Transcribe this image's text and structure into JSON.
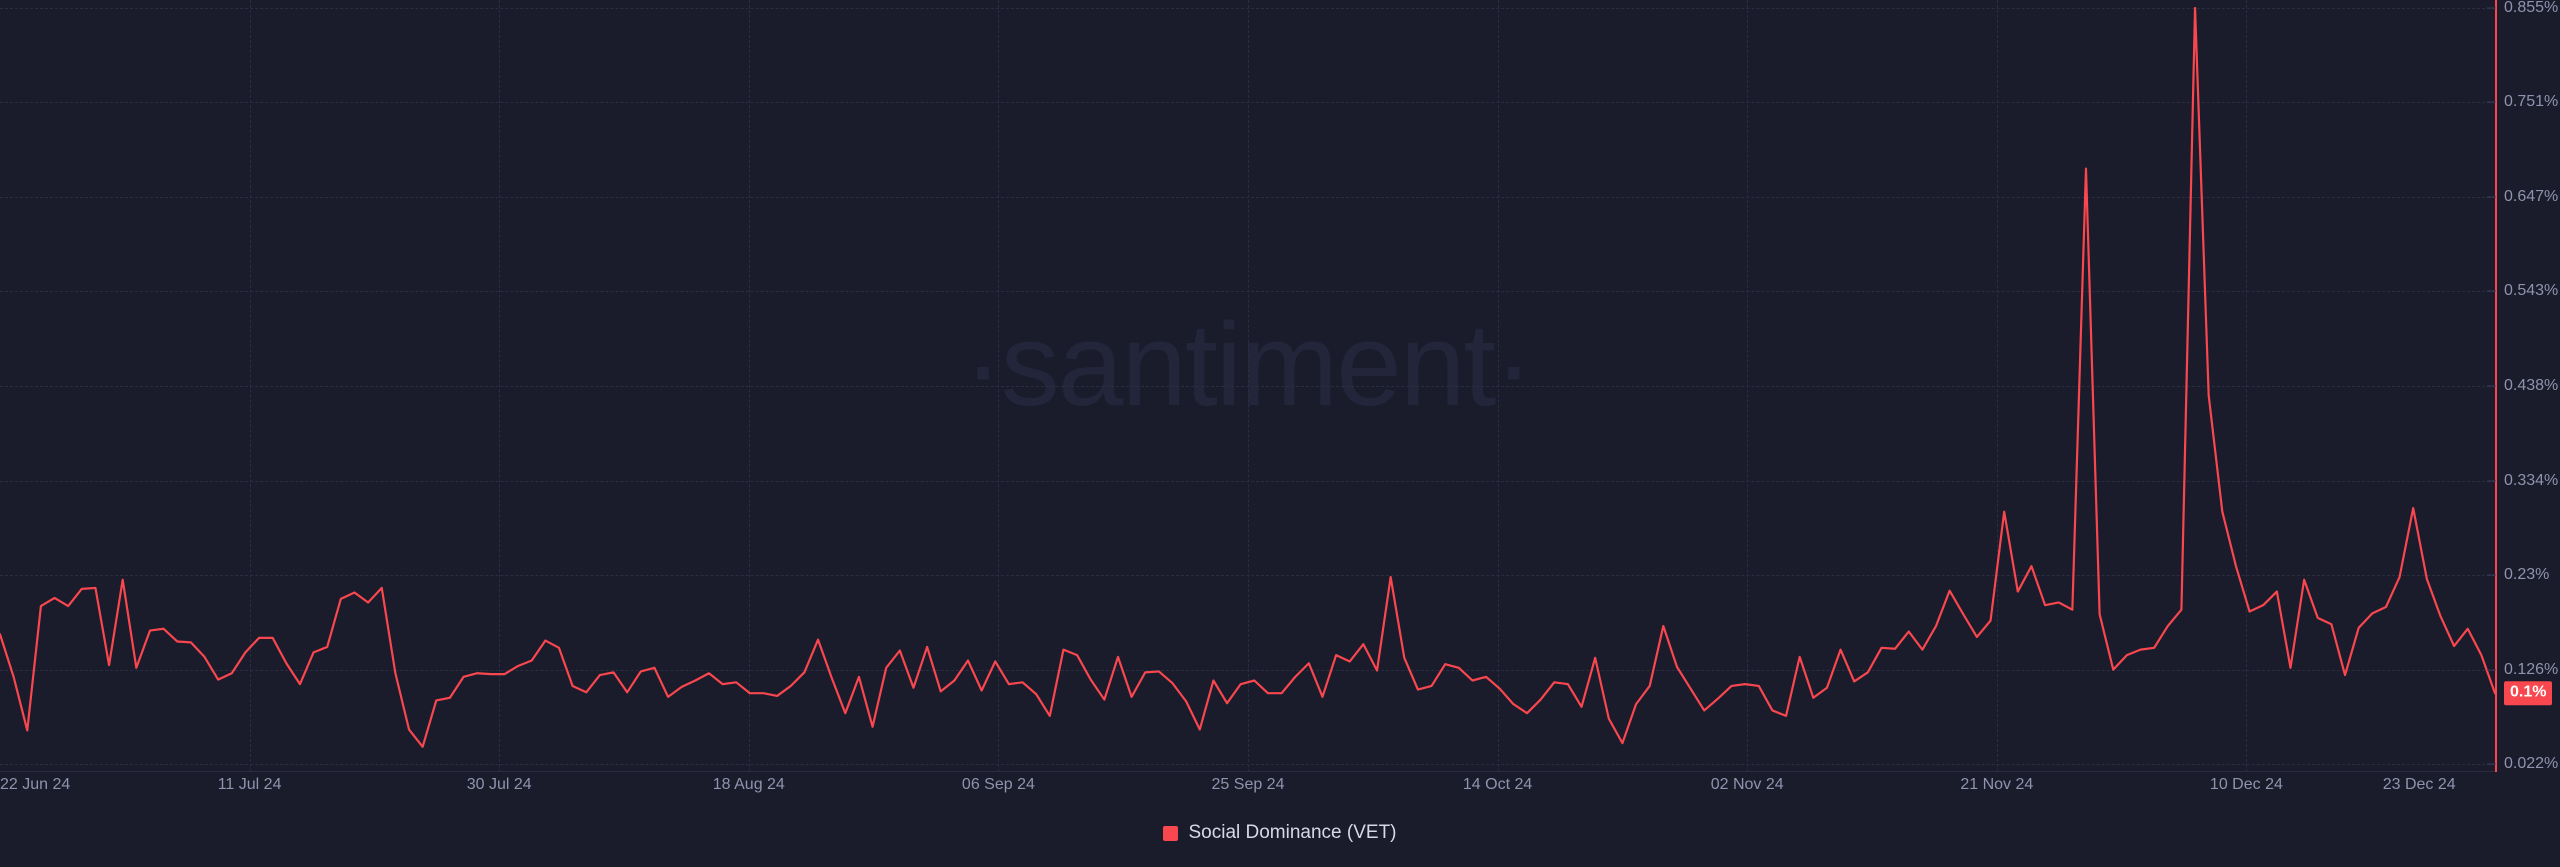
{
  "theme": {
    "background": "#1a1b2b",
    "grid_color": "#2b2d42",
    "axis_text_color": "#8f93ad",
    "series_color": "#f8474e",
    "legend_text_color": "#d7d9e6",
    "watermark_color": "#23253a",
    "badge_background": "#f8474e",
    "badge_text_color": "#ffffff"
  },
  "watermark": {
    "text": "·santiment·"
  },
  "legend": {
    "position": "bottom-center",
    "items": [
      {
        "label": "Social Dominance (VET)",
        "color": "#f8474e",
        "marker": "square"
      }
    ]
  },
  "current_value_badge": {
    "text": "0.1%",
    "value": 0.1
  },
  "y_axis": {
    "labels": [
      "0.855%",
      "0.751%",
      "0.647%",
      "0.543%",
      "0.438%",
      "0.334%",
      "0.23%",
      "0.126%",
      "0.022%"
    ],
    "values": [
      0.855,
      0.751,
      0.647,
      0.543,
      0.438,
      0.334,
      0.23,
      0.126,
      0.022
    ]
  },
  "x_axis": {
    "labels": [
      "22 Jun 24",
      "11 Jul 24",
      "30 Jul 24",
      "18 Aug 24",
      "06 Sep 24",
      "25 Sep 24",
      "14 Oct 24",
      "02 Nov 24",
      "21 Nov 24",
      "10 Dec 24",
      "23 Dec 24"
    ],
    "positions": [
      0,
      9.75,
      19.5,
      29.25,
      39.0,
      48.75,
      58.5,
      68.25,
      78.0,
      87.75,
      94.5
    ]
  },
  "chart_data": {
    "type": "line",
    "title": "Social Dominance (VET)",
    "xlabel": "",
    "ylabel": "Social Dominance",
    "unit": "%",
    "grid": true,
    "legend_position": "bottom-center",
    "xlim": [
      "22 Jun 24",
      "23 Dec 24"
    ],
    "ylim": [
      0.022,
      0.855
    ],
    "yticks": [
      0.022,
      0.126,
      0.23,
      0.334,
      0.438,
      0.543,
      0.647,
      0.751,
      0.855
    ],
    "xticks": [
      "22 Jun 24",
      "11 Jul 24",
      "30 Jul 24",
      "18 Aug 24",
      "06 Sep 24",
      "25 Sep 24",
      "14 Oct 24",
      "02 Nov 24",
      "21 Nov 24",
      "10 Dec 24",
      "23 Dec 24"
    ],
    "last_value": 0.1,
    "series": [
      {
        "name": "Social Dominance (VET)",
        "color": "#f8474e",
        "values": [
          0.165,
          0.118,
          0.059,
          0.196,
          0.205,
          0.196,
          0.215,
          0.216,
          0.131,
          0.225,
          0.128,
          0.169,
          0.171,
          0.157,
          0.156,
          0.14,
          0.115,
          0.122,
          0.145,
          0.161,
          0.161,
          0.133,
          0.11,
          0.145,
          0.151,
          0.204,
          0.211,
          0.2,
          0.216,
          0.122,
          0.06,
          0.041,
          0.092,
          0.095,
          0.118,
          0.122,
          0.121,
          0.121,
          0.13,
          0.136,
          0.158,
          0.15,
          0.108,
          0.101,
          0.12,
          0.123,
          0.101,
          0.124,
          0.128,
          0.096,
          0.107,
          0.114,
          0.122,
          0.11,
          0.112,
          0.1,
          0.1,
          0.097,
          0.108,
          0.123,
          0.159,
          0.117,
          0.078,
          0.118,
          0.063,
          0.128,
          0.147,
          0.106,
          0.151,
          0.102,
          0.114,
          0.136,
          0.103,
          0.135,
          0.11,
          0.112,
          0.099,
          0.075,
          0.148,
          0.142,
          0.115,
          0.093,
          0.14,
          0.096,
          0.123,
          0.124,
          0.111,
          0.091,
          0.06,
          0.114,
          0.089,
          0.11,
          0.114,
          0.1,
          0.1,
          0.118,
          0.133,
          0.096,
          0.142,
          0.135,
          0.154,
          0.125,
          0.228,
          0.139,
          0.104,
          0.108,
          0.132,
          0.128,
          0.114,
          0.118,
          0.105,
          0.088,
          0.078,
          0.093,
          0.112,
          0.11,
          0.085,
          0.139,
          0.072,
          0.045,
          0.088,
          0.108,
          0.174,
          0.129,
          0.105,
          0.081,
          0.094,
          0.108,
          0.11,
          0.108,
          0.081,
          0.075,
          0.14,
          0.095,
          0.106,
          0.148,
          0.113,
          0.123,
          0.15,
          0.149,
          0.168,
          0.148,
          0.174,
          0.213,
          0.187,
          0.162,
          0.18,
          0.3,
          0.212,
          0.24,
          0.197,
          0.2,
          0.192,
          0.678,
          0.187,
          0.126,
          0.142,
          0.148,
          0.15,
          0.174,
          0.192,
          0.855,
          0.428,
          0.3,
          0.24,
          0.19,
          0.197,
          0.212,
          0.128,
          0.225,
          0.183,
          0.176,
          0.12,
          0.172,
          0.188,
          0.195,
          0.228,
          0.304,
          0.226,
          0.185,
          0.152,
          0.171,
          0.142,
          0.1
        ]
      }
    ]
  }
}
